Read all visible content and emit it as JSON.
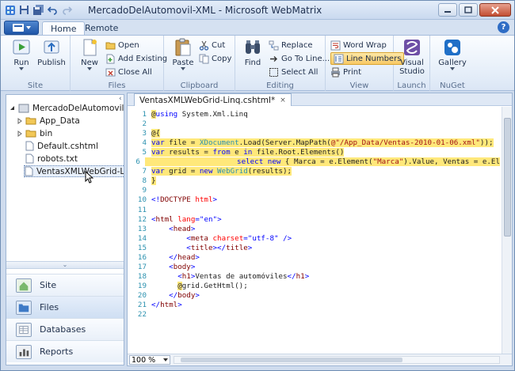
{
  "window": {
    "title": "MercadoDelAutomovil-XML - Microsoft WebMatrix"
  },
  "ribbon": {
    "tabs": [
      {
        "label": "Home"
      },
      {
        "label": "Remote"
      }
    ],
    "groups": {
      "site": {
        "label": "Site",
        "run": "Run",
        "publish": "Publish"
      },
      "files": {
        "label": "Files",
        "new": "New",
        "open": "Open",
        "add_existing": "Add Existing",
        "close_all": "Close All"
      },
      "clipboard": {
        "label": "Clipboard",
        "paste": "Paste",
        "cut": "Cut",
        "copy": "Copy"
      },
      "editing": {
        "label": "Editing",
        "find": "Find",
        "replace": "Replace",
        "go_to_line": "Go To Line...",
        "select_all": "Select All"
      },
      "view": {
        "label": "View",
        "word_wrap": "Word Wrap",
        "line_numbers": "Line Numbers",
        "print": "Print"
      },
      "launch": {
        "label": "Launch",
        "visual_studio": "Visual Studio"
      },
      "nuget": {
        "label": "NuGet",
        "gallery": "Gallery"
      }
    }
  },
  "tree": {
    "root": "MercadoDelAutomovil-XML",
    "items": [
      {
        "label": "App_Data"
      },
      {
        "label": "bin"
      },
      {
        "label": "Default.cshtml"
      },
      {
        "label": "robots.txt"
      },
      {
        "label": "VentasXMLWebGrid-Linq.c"
      }
    ]
  },
  "workspaces": [
    {
      "label": "Site"
    },
    {
      "label": "Files"
    },
    {
      "label": "Databases"
    },
    {
      "label": "Reports"
    }
  ],
  "editor": {
    "tab_label": "VentasXMLWebGrid-Linq.cshtml*",
    "tab_close": "×",
    "zoom": "100 %",
    "lines": [
      {
        "n": "1",
        "html": "<span class='r'>@</span><span class='k'>using</span> System.Xml.Linq"
      },
      {
        "n": "2",
        "html": ""
      },
      {
        "n": "3",
        "html": "<span class='r'>@{</span>"
      },
      {
        "n": "4",
        "html": "<span class='r'><span class='k'>var</span> file = <span class='t'>XDocument</span>.Load(Server.MapPath(<span class='s'>@\"/App_Data/Ventas-2010-01-06.xml\"</span>));</span>"
      },
      {
        "n": "5",
        "html": "<span class='r'><span class='k'>var</span> results = <span class='k'>from</span> e <span class='k'>in</span> file.Root.Elements()</span>"
      },
      {
        "n": "6",
        "html": "<span class='r'>                     <span class='k'>select</span> <span class='k'>new</span> { Marca = e.Element(<span class='s'>\"Marca\"</span>).Value, Ventas = e.El</span>"
      },
      {
        "n": "7",
        "html": "<span class='r'><span class='k'>var</span> grid = <span class='k'>new</span> <span class='t'>WebGrid</span>(results);</span>"
      },
      {
        "n": "8",
        "html": "<span class='r'>}</span>"
      },
      {
        "n": "9",
        "html": ""
      },
      {
        "n": "10",
        "html": "<span class='bl'>&lt;!</span><span class='tag'>DOCTYPE</span> <span class='at'>html</span><span class='bl'>&gt;</span>"
      },
      {
        "n": "11",
        "html": ""
      },
      {
        "n": "12",
        "html": "<span class='bl'>&lt;</span><span class='tag'>html</span> <span class='at'>lang</span><span class='bl'>=</span><span class='bl'>\"en\"</span><span class='bl'>&gt;</span>"
      },
      {
        "n": "13",
        "html": "    <span class='bl'>&lt;</span><span class='tag'>head</span><span class='bl'>&gt;</span>"
      },
      {
        "n": "14",
        "html": "        <span class='bl'>&lt;</span><span class='tag'>meta</span> <span class='at'>charset</span><span class='bl'>=</span><span class='bl'>\"utf-8\"</span> <span class='bl'>/&gt;</span>"
      },
      {
        "n": "15",
        "html": "        <span class='bl'>&lt;</span><span class='tag'>title</span><span class='bl'>&gt;&lt;/</span><span class='tag'>title</span><span class='bl'>&gt;</span>"
      },
      {
        "n": "16",
        "html": "    <span class='bl'>&lt;/</span><span class='tag'>head</span><span class='bl'>&gt;</span>"
      },
      {
        "n": "17",
        "html": "    <span class='bl'>&lt;</span><span class='tag'>body</span><span class='bl'>&gt;</span>"
      },
      {
        "n": "18",
        "html": "      <span class='bl'>&lt;</span><span class='tag'>h1</span><span class='bl'>&gt;</span>Ventas de automóviles<span class='bl'>&lt;/</span><span class='tag'>h1</span><span class='bl'>&gt;</span>"
      },
      {
        "n": "19",
        "html": "      <span class='r'>@</span>grid.GetHtml();"
      },
      {
        "n": "20",
        "html": "    <span class='bl'>&lt;/</span><span class='tag'>body</span><span class='bl'>&gt;</span>"
      },
      {
        "n": "21",
        "html": "<span class='bl'>&lt;/</span><span class='tag'>html</span><span class='bl'>&gt;</span>"
      },
      {
        "n": "22",
        "html": ""
      }
    ]
  },
  "icons": {
    "title": "webmatrix-icon",
    "save": "save-icon",
    "save_all": "save-all-icon",
    "undo": "undo-icon",
    "redo": "redo-icon",
    "minimize": "minimize-icon",
    "maximize": "maximize-icon",
    "close": "close-icon",
    "help": "help-icon"
  },
  "colors": {
    "accent": "#2f6dc5",
    "razor_highlight": "#ffe87a",
    "line_numbers": "#2b91af",
    "keyword": "#0000ff",
    "string": "#a31515"
  }
}
